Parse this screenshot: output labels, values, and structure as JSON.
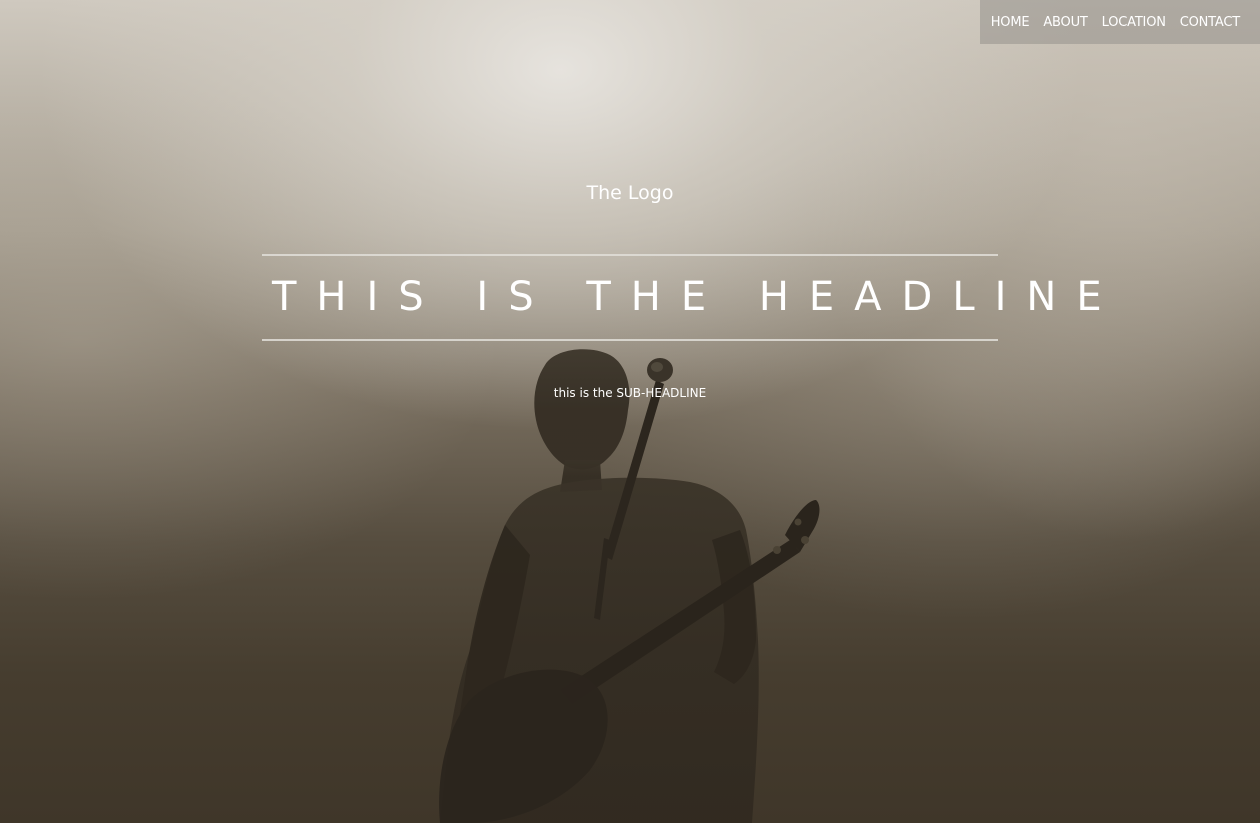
{
  "nav": {
    "items": [
      {
        "label": "HOME"
      },
      {
        "label": "ABOUT"
      },
      {
        "label": "LOCATION"
      },
      {
        "label": "CONTACT"
      }
    ]
  },
  "hero": {
    "logo": "The Logo",
    "headline": "THIS IS THE HEADLINE",
    "subheadline": "this is the SUB-HEADLINE"
  },
  "colors": {
    "text": "#ffffff",
    "nav_background": "#96918c",
    "rule": "#e1ded8"
  }
}
